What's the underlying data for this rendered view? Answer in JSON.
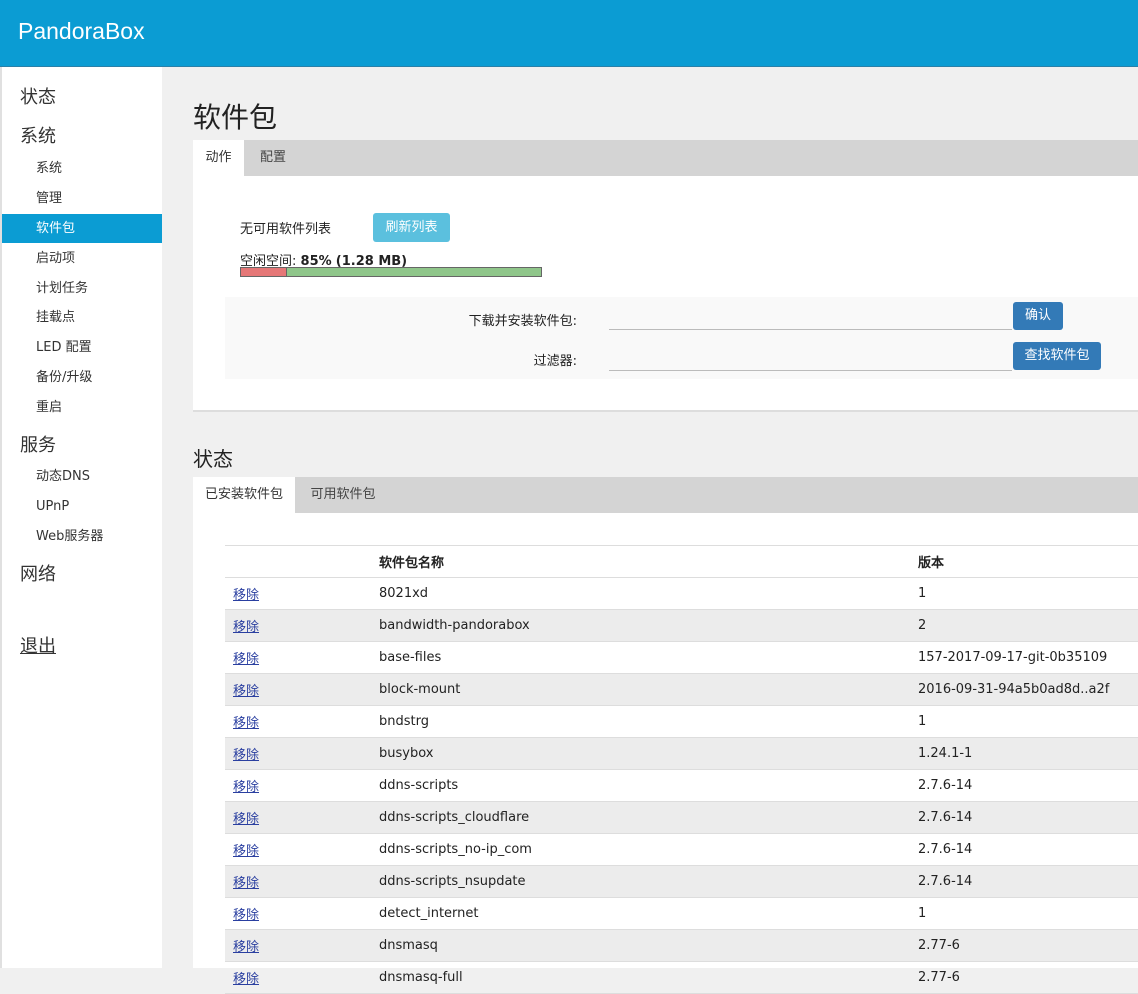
{
  "app": {
    "brand": "PandoraBox"
  },
  "sidebar": {
    "groups": [
      {
        "label": "状态"
      },
      {
        "label": "系统",
        "items": [
          "系统",
          "管理",
          "软件包",
          "启动项",
          "计划任务",
          "挂载点",
          "LED 配置",
          "备份/升级",
          "重启"
        ]
      },
      {
        "label": "服务",
        "items": [
          "动态DNS",
          "UPnP",
          "Web服务器"
        ]
      },
      {
        "label": "网络"
      }
    ],
    "active_item": "软件包",
    "logout": "退出"
  },
  "page": {
    "title": "软件包"
  },
  "actions_tabs": [
    "动作",
    "配置"
  ],
  "actions": {
    "no_list_text": "无可用软件列表",
    "refresh_button": "刷新列表",
    "free_space_label": "空闲空间:",
    "free_space_value": "85%",
    "free_space_size": "(1.28 MB)",
    "free_fraction": 0.85,
    "download_label": "下载并安装软件包:",
    "confirm_button": "确认",
    "filter_label": "过滤器:",
    "find_button": "查找软件包"
  },
  "status": {
    "title": "状态",
    "tabs": [
      "已安装软件包",
      "可用软件包"
    ],
    "columns": [
      "",
      "软件包名称",
      "版本"
    ],
    "remove_label": "移除",
    "rows": [
      {
        "name": "8021xd",
        "version": "1"
      },
      {
        "name": "bandwidth-pandorabox",
        "version": "2"
      },
      {
        "name": "base-files",
        "version": "157-2017-09-17-git-0b35109"
      },
      {
        "name": "block-mount",
        "version": "2016-09-31-94a5b0ad8d..a2f"
      },
      {
        "name": "bndstrg",
        "version": "1"
      },
      {
        "name": "busybox",
        "version": "1.24.1-1"
      },
      {
        "name": "ddns-scripts",
        "version": "2.7.6-14"
      },
      {
        "name": "ddns-scripts_cloudflare",
        "version": "2.7.6-14"
      },
      {
        "name": "ddns-scripts_no-ip_com",
        "version": "2.7.6-14"
      },
      {
        "name": "ddns-scripts_nsupdate",
        "version": "2.7.6-14"
      },
      {
        "name": "detect_internet",
        "version": "1"
      },
      {
        "name": "dnsmasq",
        "version": "2.77-6"
      },
      {
        "name": "dnsmasq-full",
        "version": "2.77-6"
      }
    ]
  },
  "colors": {
    "header": "#0b9cd3",
    "active_nav": "#0b9cd3",
    "refresh_button": "#5bc0de",
    "primary_button": "#337ab7",
    "used_bar": "#e57777",
    "free_bar": "#8fc68a"
  }
}
